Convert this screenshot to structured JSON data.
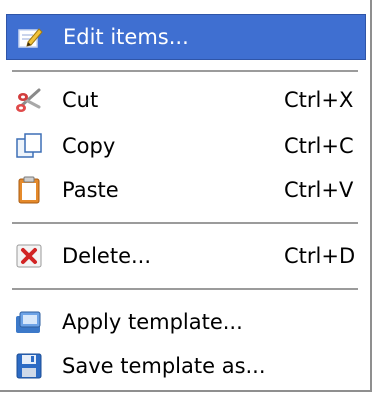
{
  "menu": {
    "items": [
      {
        "label": "Edit items...",
        "shortcut": "",
        "icon": "edit-pencil-icon"
      },
      {
        "label": "Cut",
        "shortcut": "Ctrl+X",
        "icon": "scissors-icon"
      },
      {
        "label": "Copy",
        "shortcut": "Ctrl+C",
        "icon": "copy-icon"
      },
      {
        "label": "Paste",
        "shortcut": "Ctrl+V",
        "icon": "paste-clipboard-icon"
      },
      {
        "label": "Delete...",
        "shortcut": "Ctrl+D",
        "icon": "delete-x-icon"
      },
      {
        "label": "Apply template...",
        "shortcut": "",
        "icon": "apply-template-icon"
      },
      {
        "label": "Save template as...",
        "shortcut": "",
        "icon": "save-floppy-icon"
      }
    ],
    "selected_index": 0
  },
  "colors": {
    "selection": "#3f6fd1",
    "separator": "#9b9b9b"
  }
}
